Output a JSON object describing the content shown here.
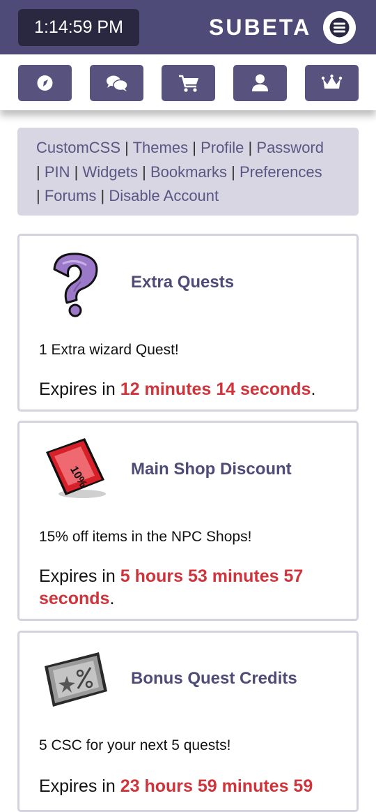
{
  "header": {
    "clock": "1:14:59 PM",
    "brand": "SUBETA",
    "menu_icon": "hamburger-menu-icon"
  },
  "nav_icons": [
    {
      "name": "compass-icon"
    },
    {
      "name": "chat-bubbles-icon"
    },
    {
      "name": "shopping-cart-icon"
    },
    {
      "name": "user-icon"
    },
    {
      "name": "crown-icon"
    }
  ],
  "settings_links": [
    "CustomCSS",
    "Themes",
    "Profile",
    "Password",
    "PIN",
    "Widgets",
    "Bookmarks",
    "Preferences",
    "Forums",
    "Disable Account"
  ],
  "link_separator": "|",
  "perks": [
    {
      "title": "Extra Quests",
      "description": "1 Extra wizard Quest!",
      "expires_prefix": "Expires in ",
      "expires_time": "12 minutes 14 seconds",
      "expires_suffix": ".",
      "icon": "question-mark-icon"
    },
    {
      "title": "Main Shop Discount",
      "description": "15% off items in the NPC Shops!",
      "expires_prefix": "Expires in ",
      "expires_time": "5 hours 53 minutes 57 seconds",
      "expires_suffix": ".",
      "icon": "discount-ticket-icon",
      "icon_text": "10%"
    },
    {
      "title": "Bonus Quest Credits",
      "description": "5 CSC for your next 5 quests!",
      "expires_prefix": "Expires in ",
      "expires_time": "23 hours 59 minutes 59",
      "expires_suffix": "",
      "icon": "quest-credit-icon"
    }
  ],
  "colors": {
    "header_bg": "#4f4b78",
    "button_bg": "#57537e",
    "panel_bg": "#d8d6e2",
    "accent_red": "#d0343b"
  }
}
